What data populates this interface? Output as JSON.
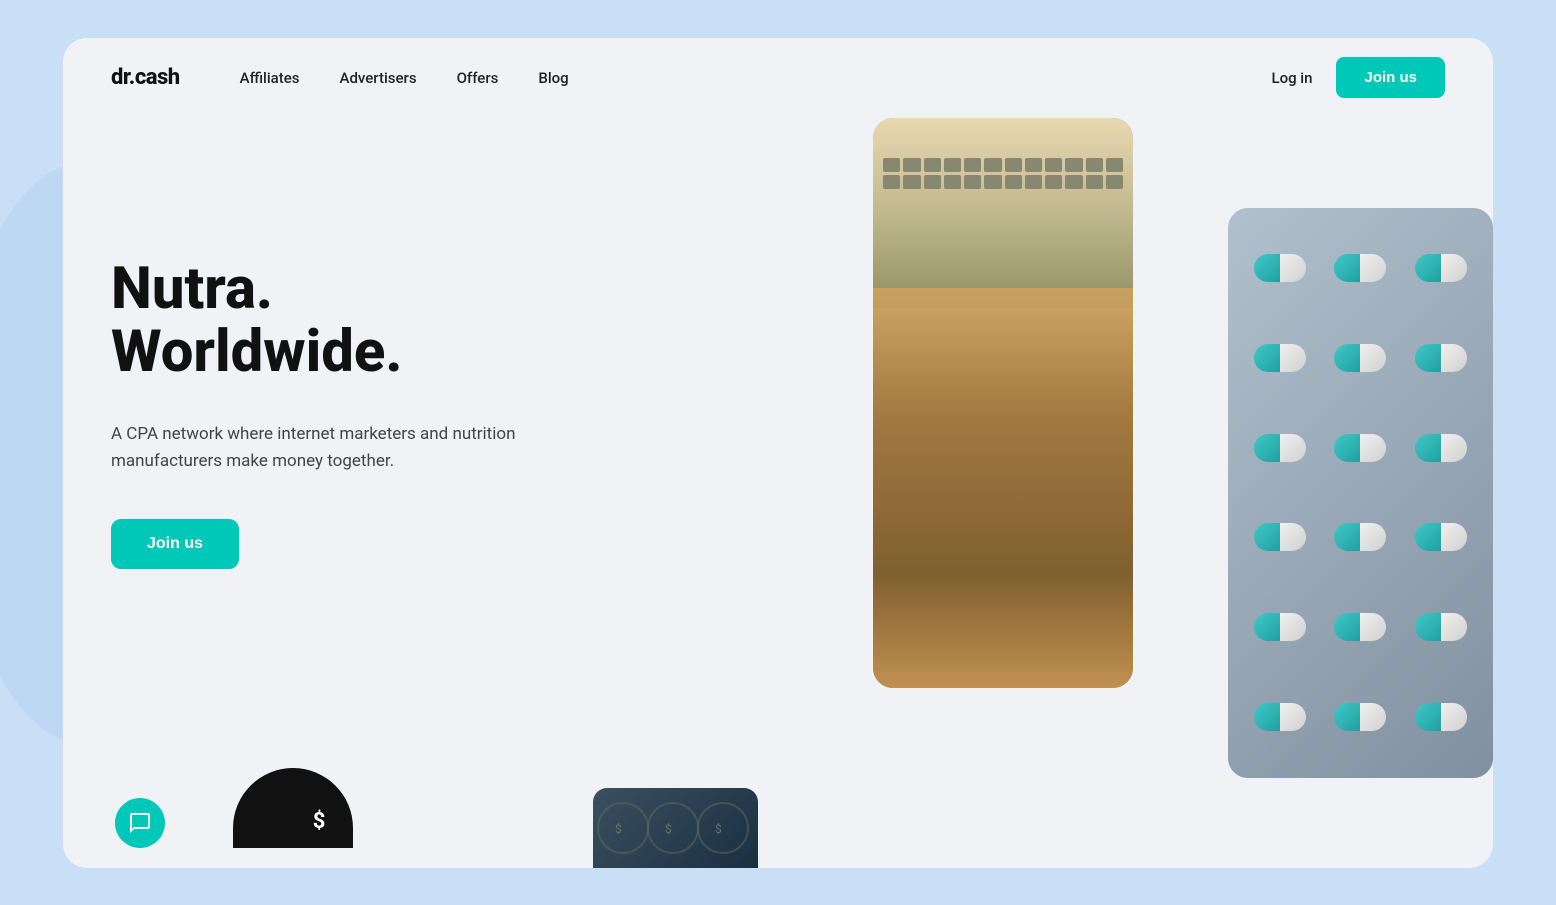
{
  "brand": {
    "logo": "dr.cash"
  },
  "navbar": {
    "links": [
      {
        "label": "Affiliates",
        "id": "affiliates"
      },
      {
        "label": "Advertisers",
        "id": "advertisers"
      },
      {
        "label": "Offers",
        "id": "offers"
      },
      {
        "label": "Blog",
        "id": "blog"
      }
    ],
    "login_label": "Log in",
    "join_label": "Join us"
  },
  "hero": {
    "title_line1": "Nutra.",
    "title_line2": "Worldwide.",
    "subtitle": "A CPA network where internet marketers and nutrition manufacturers make money together.",
    "cta_label": "Join us"
  },
  "colors": {
    "accent": "#00c8b8",
    "dark": "#111111",
    "body_bg": "#c8dff5",
    "card_bg": "#f0f2f5"
  }
}
